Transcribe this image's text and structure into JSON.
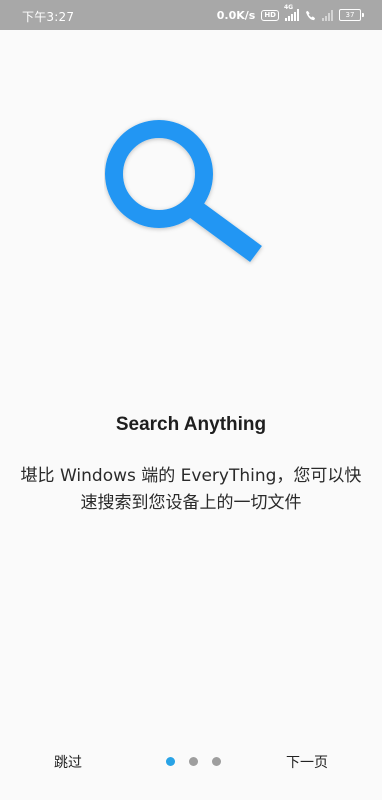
{
  "status_bar": {
    "time": "下午3:27",
    "network_speed": "0.0K/s",
    "hd_label": "HD",
    "network_type": "4G",
    "battery_level": "37"
  },
  "hero": {
    "icon": "search-icon",
    "icon_color": "#2196F3"
  },
  "content": {
    "title": "Search Anything",
    "description": "堪比 Windows 端的 EveryThing，您可以快速搜索到您设备上的一切文件"
  },
  "pager": {
    "page_count": 3,
    "active_index": 0,
    "active_color": "#29a3e6"
  },
  "nav": {
    "skip_label": "跳过",
    "next_label": "下一页"
  }
}
